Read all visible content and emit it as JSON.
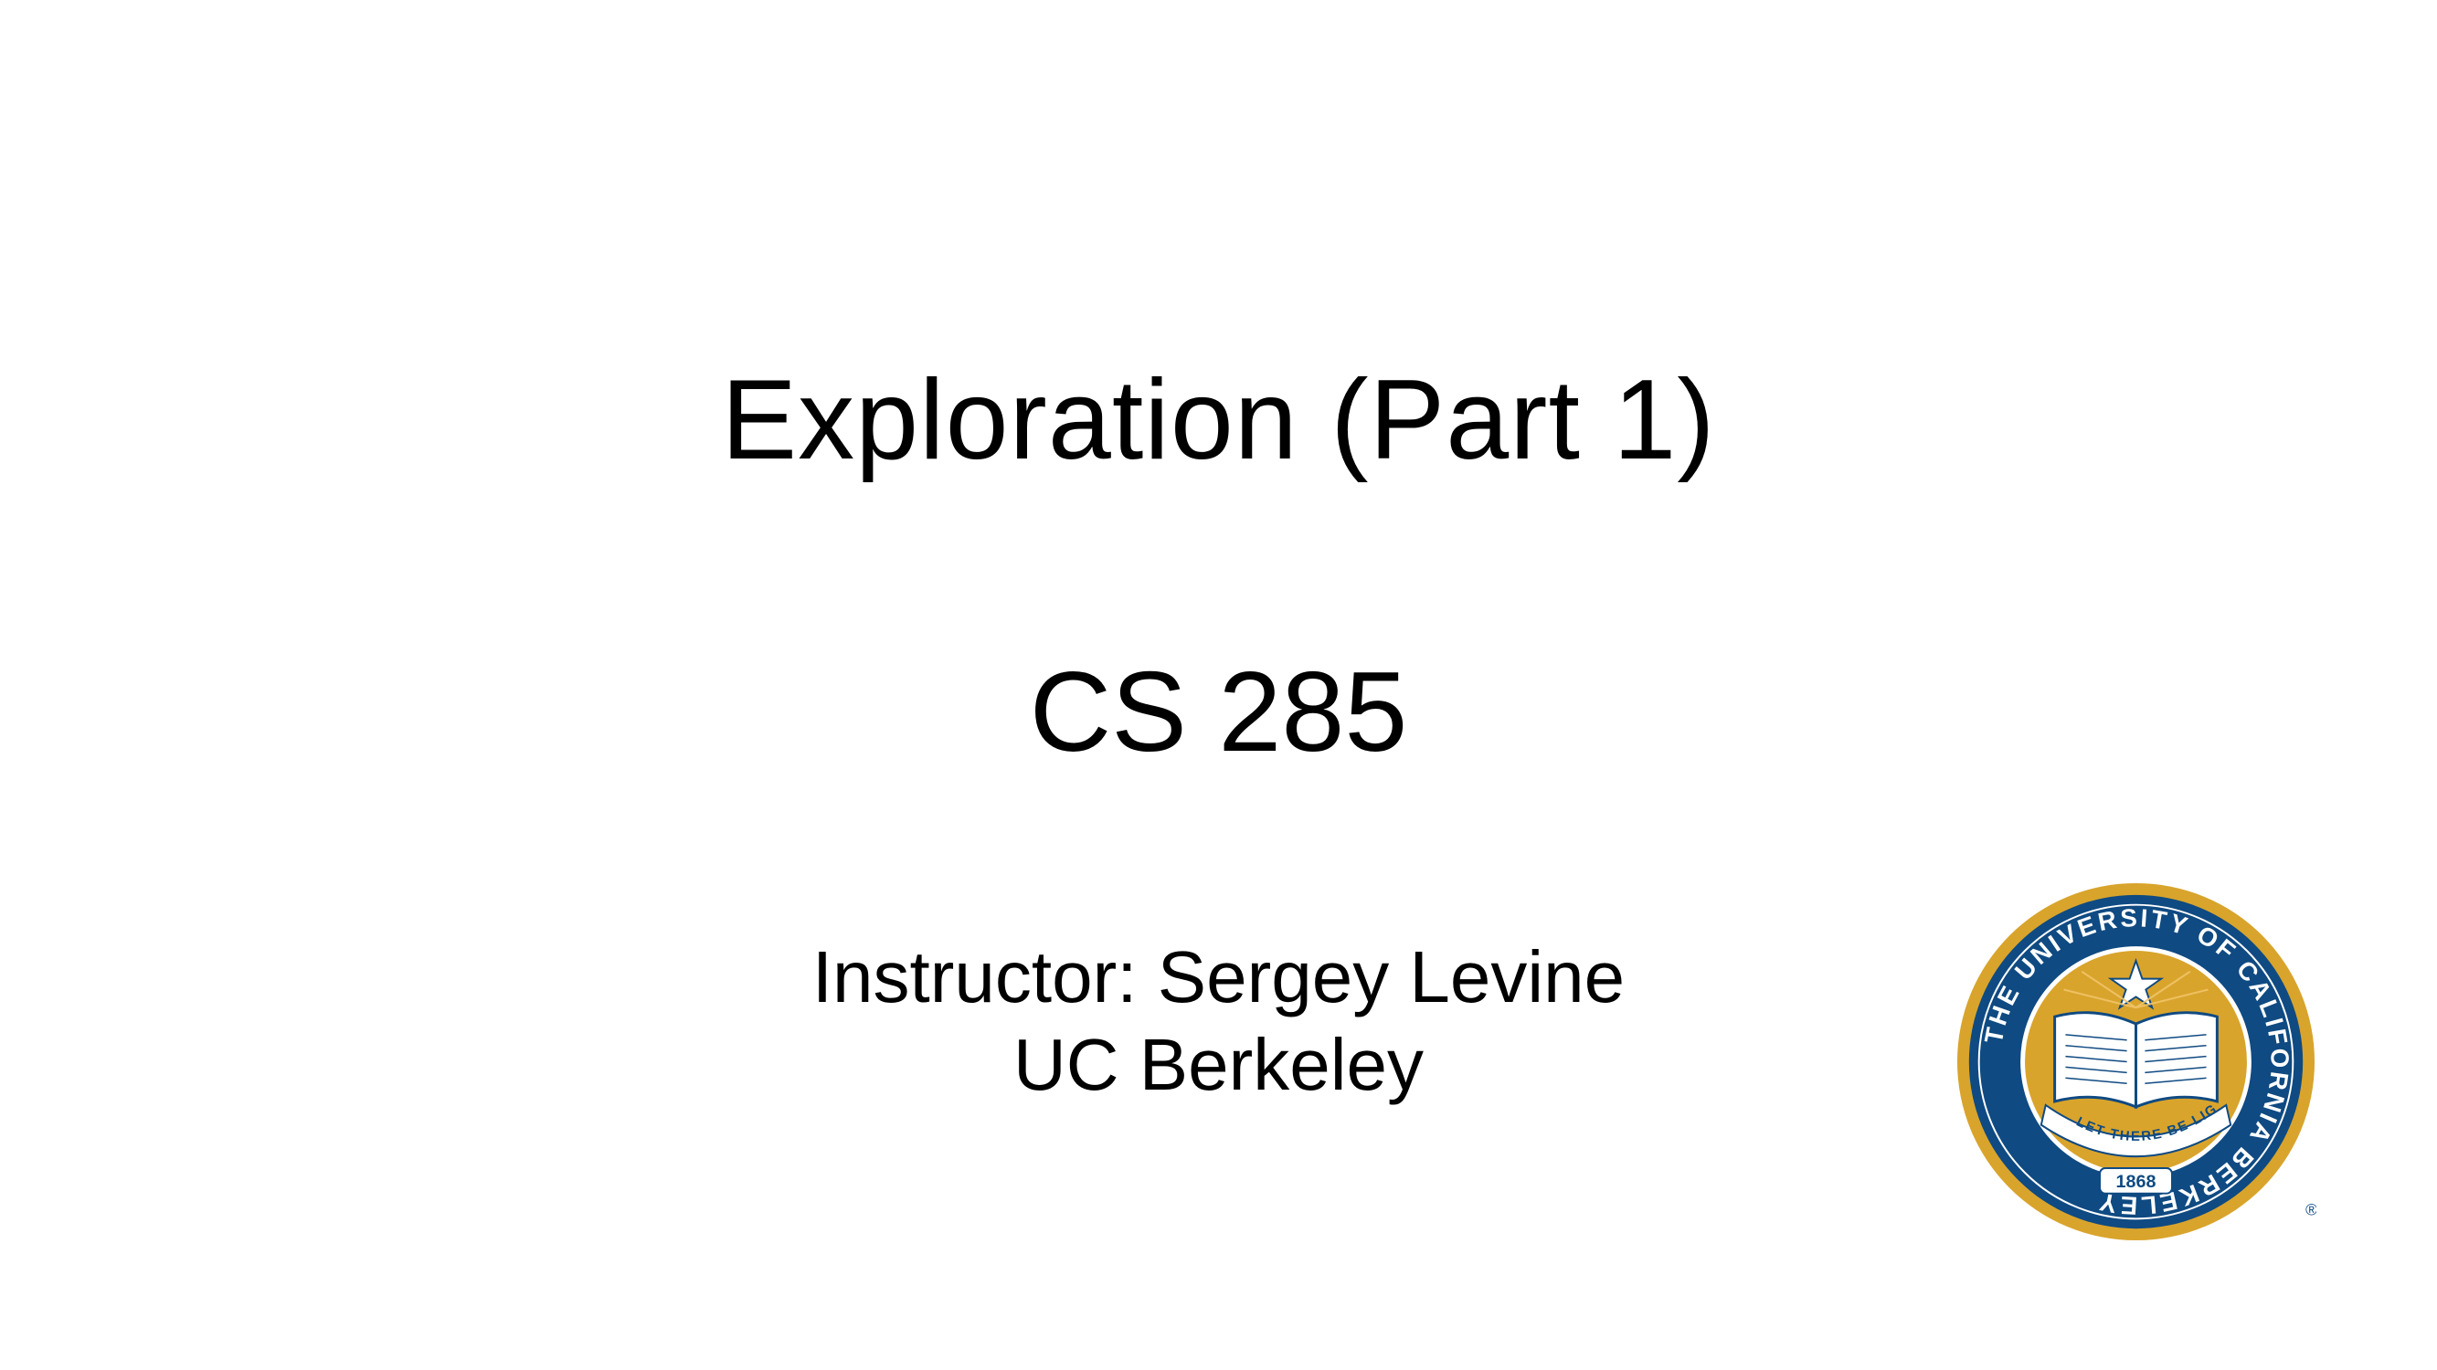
{
  "slide": {
    "title": "Exploration (Part 1)",
    "course": "CS 285",
    "instructor_line": "Instructor: Sergey Levine",
    "institution_line": "UC Berkeley"
  },
  "seal": {
    "ring_text": "THE UNIVERSITY OF CALIFORNIA BERKELEY",
    "motto_text": "LET THERE BE LIGHT",
    "year_text": "1868",
    "registered_mark": "®",
    "colors": {
      "navy": "#0f4a82",
      "gold": "#d9a42c",
      "light_gold": "#f1c56a",
      "white": "#ffffff"
    }
  }
}
